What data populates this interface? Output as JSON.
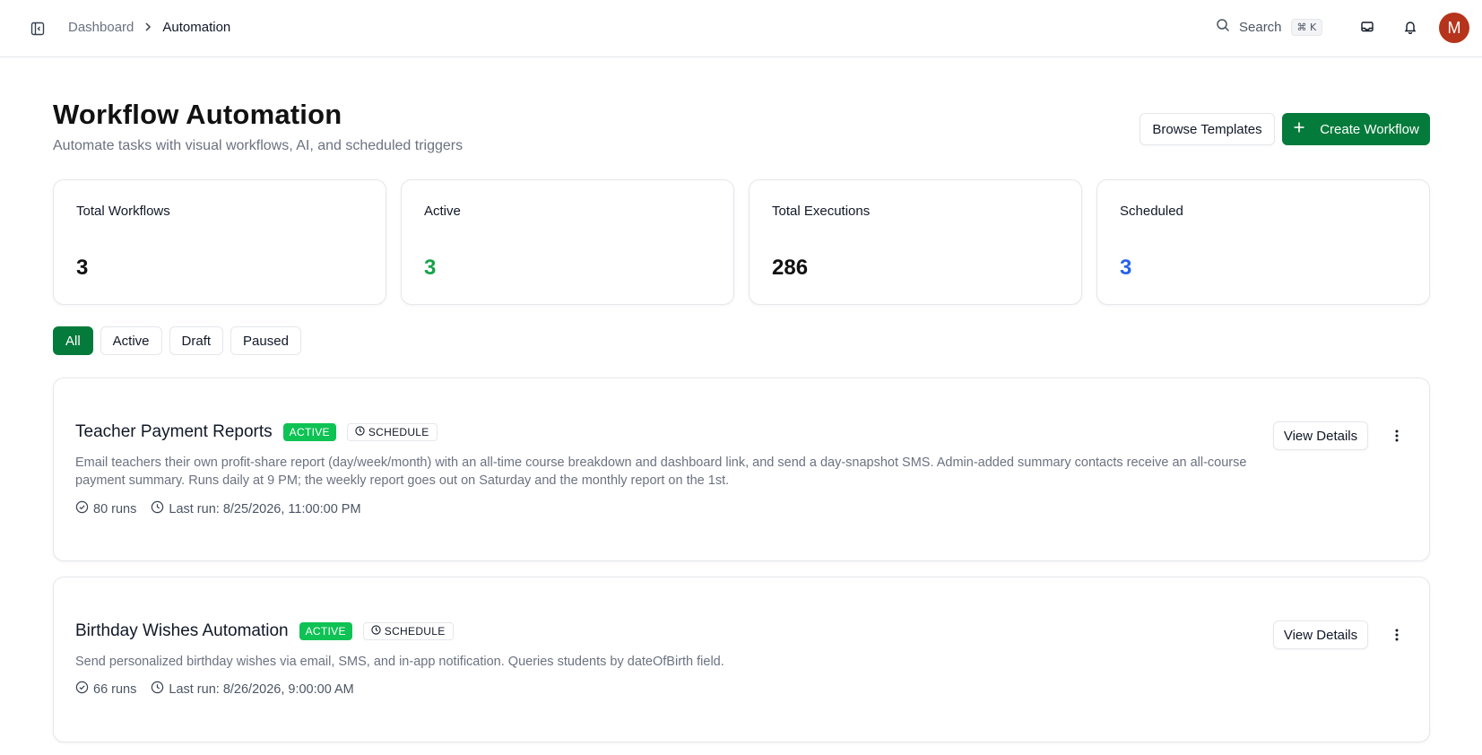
{
  "breadcrumb": {
    "parent": "Dashboard",
    "current": "Automation"
  },
  "search": {
    "label": "Search",
    "shortcut": "⌘ K"
  },
  "user": {
    "avatar_initial": "M",
    "avatar_color": "#b5341b"
  },
  "header": {
    "title": "Workflow Automation",
    "subtitle": "Automate tasks with visual workflows, AI, and scheduled triggers",
    "browse_templates_label": "Browse Templates",
    "create_workflow_label": "Create Workflow"
  },
  "stats": [
    {
      "label": "Total Workflows",
      "value": "3",
      "color": "#111111"
    },
    {
      "label": "Active",
      "value": "3",
      "color": "#16a34a"
    },
    {
      "label": "Total Executions",
      "value": "286",
      "color": "#111111"
    },
    {
      "label": "Scheduled",
      "value": "3",
      "color": "#2563eb"
    }
  ],
  "filters": [
    {
      "label": "All",
      "selected": true
    },
    {
      "label": "Active",
      "selected": false
    },
    {
      "label": "Draft",
      "selected": false
    },
    {
      "label": "Paused",
      "selected": false
    }
  ],
  "workflows": [
    {
      "title": "Teacher Payment Reports",
      "status": "ACTIVE",
      "trigger": "SCHEDULE",
      "description": "Email teachers their own profit-share report (day/week/month) with an all-time course breakdown and dashboard link, and send a day-snapshot SMS. Admin-added summary contacts receive an all-course payment summary. Runs daily at 9 PM; the weekly report goes out on Saturday and the monthly report on the 1st.",
      "runs": "80 runs",
      "last_run": "Last run: 8/25/2026, 11:00:00 PM",
      "details_label": "View Details"
    },
    {
      "title": "Birthday Wishes Automation",
      "status": "ACTIVE",
      "trigger": "SCHEDULE",
      "description": "Send personalized birthday wishes via email, SMS, and in-app notification. Queries students by dateOfBirth field.",
      "runs": "66 runs",
      "last_run": "Last run: 8/26/2026, 9:00:00 AM",
      "details_label": "View Details"
    }
  ],
  "colors": {
    "brand": "#047a3b",
    "active_badge": "#0ec254"
  },
  "icons": [
    "sidebar-toggle-icon",
    "chevron-right-icon",
    "search-icon",
    "inbox-icon",
    "bell-icon",
    "plus-icon",
    "clock-icon",
    "check-circle-icon",
    "more-vertical-icon"
  ]
}
